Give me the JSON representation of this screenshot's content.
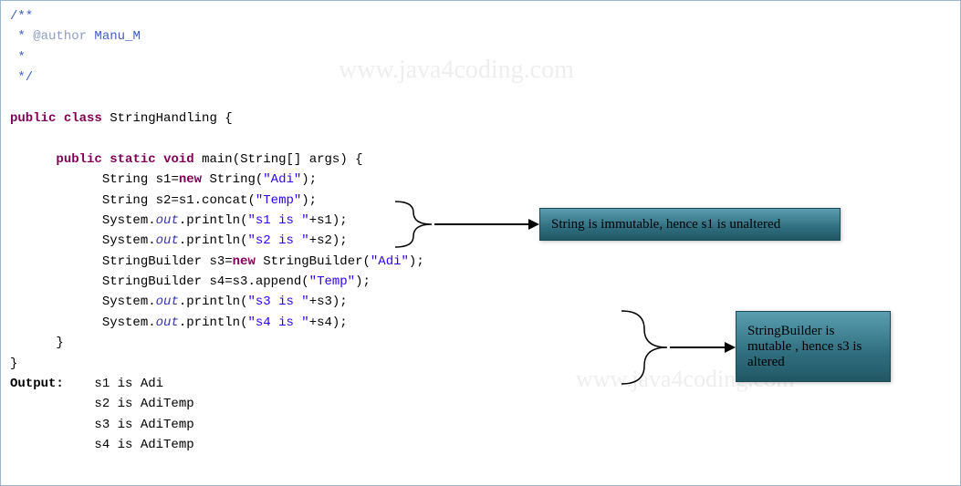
{
  "watermark": "www.java4coding.com",
  "comment": {
    "l1": "/**",
    "l2_pre": " * ",
    "l2_tag": "@author",
    "l2_txt": " Manu_M",
    "l3": " *",
    "l4": " */"
  },
  "code": {
    "kw_public": "public",
    "kw_class": "class",
    "cls_name": " StringHandling {",
    "kw_static": "static",
    "kw_void": "void",
    "main_sig": " main(String[] args) {",
    "l1a": "String s1=",
    "kw_new": "new",
    "l1b": " String(",
    "str_adi": "\"Adi\"",
    "l1c": ");",
    "l2a": "String s2=s1.concat(",
    "str_temp": "\"Temp\"",
    "l2b": ");",
    "l3a": "System.",
    "out": "out",
    "l3b": ".println(",
    "str_s1is": "\"s1 is \"",
    "l3c": "+s1);",
    "str_s2is": "\"s2 is \"",
    "l4c": "+s2);",
    "l5a": "StringBuilder s3=",
    "l5b": " StringBuilder(",
    "l5c": ");",
    "l6a": "StringBuilder s4=s3.append(",
    "l6b": ");",
    "l7a": "System.",
    "l7b": ".println(",
    "str_s3is": "\"s3 is \"",
    "l7c": "+s3);",
    "str_s4is": "\"s4 is \"",
    "l8c": "+s4);",
    "close1": "      }",
    "close2": "}"
  },
  "output": {
    "label": "Output:",
    "o1": "s1 is Adi",
    "o2": "s2 is AdiTemp",
    "o3": "s3 is AdiTemp",
    "o4": "s4 is AdiTemp"
  },
  "callouts": {
    "c1": "String is immutable, hence s1 is unaltered",
    "c2": "StringBuilder is mutable , hence s3 is altered"
  }
}
